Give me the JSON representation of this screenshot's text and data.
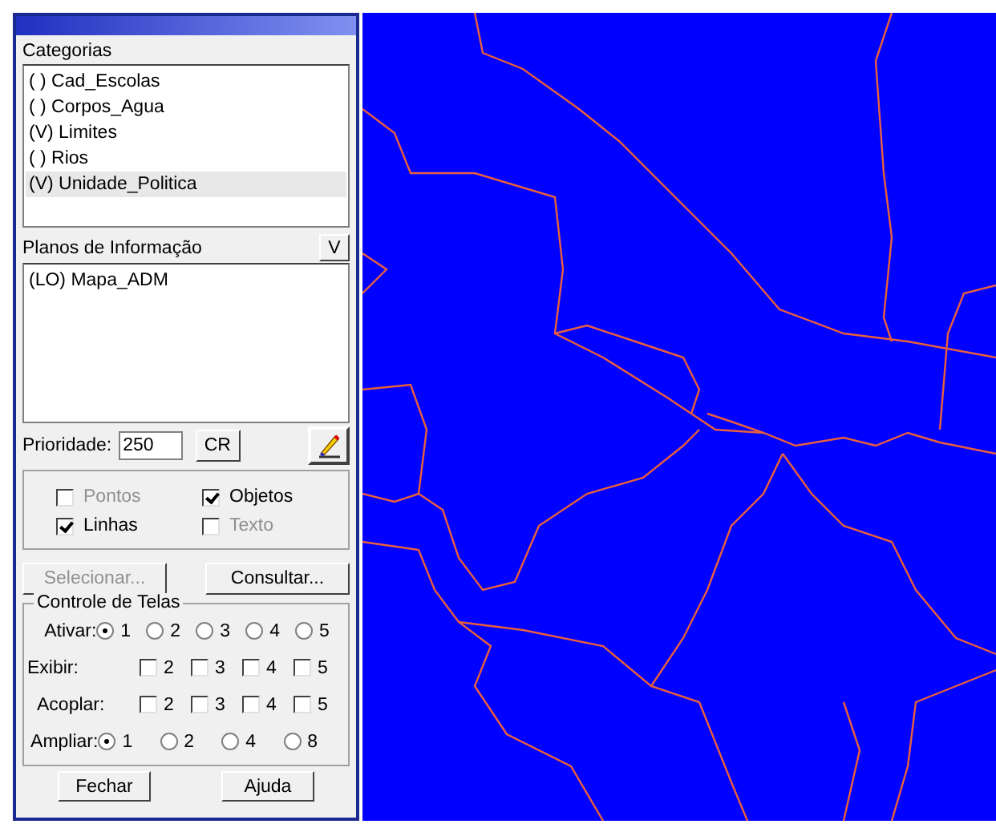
{
  "categorias": {
    "label": "Categorias",
    "items": [
      {
        "label": "( ) Cad_Escolas",
        "selected": false
      },
      {
        "label": "( ) Corpos_Agua",
        "selected": false
      },
      {
        "label": "(V) Limites",
        "selected": false
      },
      {
        "label": "( ) Rios",
        "selected": false
      },
      {
        "label": "(V) Unidade_Politica",
        "selected": true
      }
    ]
  },
  "planos": {
    "label": "Planos de Informação",
    "button": "V",
    "items": [
      {
        "label": "(LO) Mapa_ADM",
        "selected": false
      }
    ]
  },
  "prioridade": {
    "label": "Prioridade:",
    "value": "250",
    "button": "CR"
  },
  "visual": [
    {
      "label": "Pontos",
      "checked": false,
      "disabled": true
    },
    {
      "label": "Objetos",
      "checked": true,
      "disabled": false
    },
    {
      "label": "Linhas",
      "checked": true,
      "disabled": false
    },
    {
      "label": "Texto",
      "checked": false,
      "disabled": true
    }
  ],
  "actions": [
    {
      "label": "Selecionar...",
      "disabled": true
    },
    {
      "label": "Consultar...",
      "disabled": false
    }
  ],
  "controle": {
    "title": "Controle de Telas",
    "rows": [
      {
        "label": "Ativar:",
        "kind": "radio",
        "options": [
          {
            "label": "1",
            "selected": true
          },
          {
            "label": "2",
            "selected": false
          },
          {
            "label": "3",
            "selected": false
          },
          {
            "label": "4",
            "selected": false
          },
          {
            "label": "5",
            "selected": false
          }
        ]
      },
      {
        "label": "Exibir:",
        "kind": "checkbox",
        "options": [
          {
            "label": "2",
            "checked": false
          },
          {
            "label": "3",
            "checked": false
          },
          {
            "label": "4",
            "checked": false
          },
          {
            "label": "5",
            "checked": false
          }
        ]
      },
      {
        "label": "Acoplar:",
        "kind": "checkbox",
        "options": [
          {
            "label": "2",
            "checked": false
          },
          {
            "label": "3",
            "checked": false
          },
          {
            "label": "4",
            "checked": false
          },
          {
            "label": "5",
            "checked": false
          }
        ]
      },
      {
        "label": "Ampliar:",
        "kind": "radio",
        "options": [
          {
            "label": "1",
            "selected": true
          },
          {
            "label": "2",
            "selected": false
          },
          {
            "label": "4",
            "selected": false
          },
          {
            "label": "8",
            "selected": false
          }
        ]
      }
    ]
  },
  "footer": [
    "Fechar",
    "Ajuda"
  ]
}
